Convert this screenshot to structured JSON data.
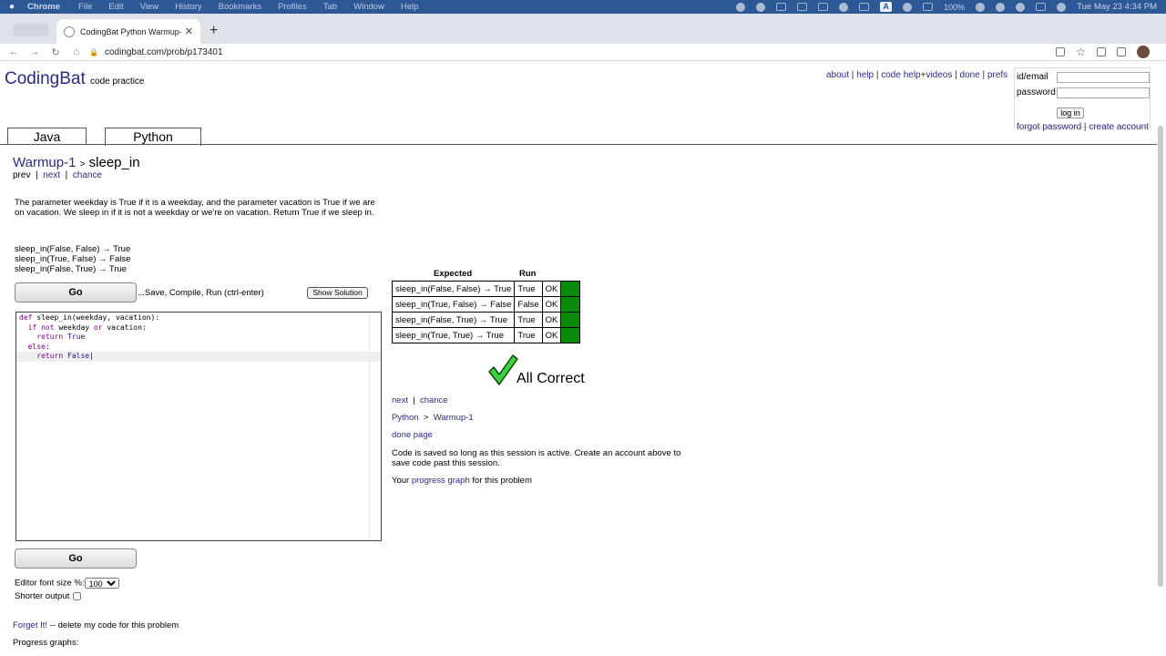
{
  "menubar": {
    "app": "Chrome",
    "items": [
      "File",
      "Edit",
      "View",
      "History",
      "Bookmarks",
      "Profiles",
      "Tab",
      "Window",
      "Help"
    ],
    "battery": "100%",
    "clock": "Tue May 23  4:34 PM"
  },
  "browser": {
    "tab_title": "CodingBat Python Warmup-1 s",
    "url": "codingbat.com/prob/p173401"
  },
  "site": {
    "logo": "CodingBat",
    "logo_sub": "code practice",
    "top_links": [
      "about",
      "help",
      "code help+videos",
      "done",
      "prefs"
    ],
    "login": {
      "id_label": "id/email",
      "password_label": "password",
      "login_button": "log in",
      "forgot": "forgot password",
      "create": "create account"
    },
    "lang_tabs": [
      "Java",
      "Python"
    ]
  },
  "problem": {
    "section": "Warmup-1",
    "separator": ">",
    "name": "sleep_in",
    "nav": [
      "prev",
      "next",
      "chance"
    ],
    "description": "The parameter weekday is True if it is a weekday, and the parameter vacation is True if we are on vacation. We sleep in if it is not a weekday or we're on vacation. Return True if we sleep in.",
    "examples": [
      "sleep_in(False, False) → True",
      "sleep_in(True, False) → False",
      "sleep_in(False, True) → True"
    ]
  },
  "controls": {
    "go_label": "Go",
    "go_hint": "...Save, Compile, Run (ctrl-enter)",
    "show_solution": "Show Solution",
    "font_label": "Editor font size %:",
    "font_value": "100",
    "shorter_label": "Shorter output",
    "forget_link": "Forget It!",
    "forget_text": " -- delete my code for this problem",
    "progress_graphs": "Progress graphs:"
  },
  "code": {
    "line1_kw": "def",
    "line1_rest": " sleep_in(weekday, vacation):",
    "line2_kw1": "if not",
    "line2_mid": " weekday ",
    "line2_kw2": "or",
    "line2_rest": " vacation:",
    "line3_kw": "return",
    "line3_val": "True",
    "line4_kw": "else",
    "line4_rest": ":",
    "line5_kw": "return",
    "line5_val": "False"
  },
  "results": {
    "col_expected": "Expected",
    "col_run": "Run",
    "rows": [
      {
        "expected": "sleep_in(False, False) → True",
        "run": "True",
        "status": "OK"
      },
      {
        "expected": "sleep_in(True, False) → False",
        "run": "False",
        "status": "OK"
      },
      {
        "expected": "sleep_in(False, True) → True",
        "run": "True",
        "status": "OK"
      },
      {
        "expected": "sleep_in(True, True) → True",
        "run": "True",
        "status": "OK"
      }
    ],
    "all_correct": "All Correct",
    "next": "next",
    "chance": "chance",
    "path_lang": "Python",
    "path_section": "Warmup-1",
    "done_page": "done page",
    "saved_note": "Code is saved so long as this session is active. Create an account above to save code past this session.",
    "your": "Your",
    "progress_graph": "progress graph",
    "for_problem": "for this problem"
  },
  "colors": {
    "link": "#2b2b80",
    "ok_green": "#0a8a0a",
    "check_green": "#3ecf3e"
  }
}
